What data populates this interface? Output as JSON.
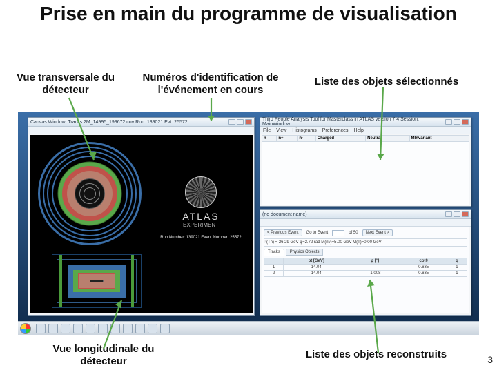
{
  "title": "Prise en main du programme de visualisation",
  "labels": {
    "transverse": "Vue transversale du détecteur",
    "evtid": "Numéros d'identification de l'événement en cours",
    "selected": "Liste des objets sélectionnés",
    "longitudinal": "Vue longitudinale du détecteur",
    "reconstructed": "Liste des objets reconstruits"
  },
  "page_number": "3",
  "canvas_window": {
    "title": "Canvas Window: Tracks 2M_14995_199672.cov Run: 139021 Evt: 25572",
    "atlas_text": "ATLAS",
    "atlas_sub": "EXPERIMENT",
    "atlas_run": "Run Number: 139021 Event Number: 25572"
  },
  "browser_window": {
    "title": "Third People Analysis Tool for Masterclass in ATLAS  version 7.4  Session: MainWindow",
    "menu": [
      "File",
      "View",
      "Histograms",
      "Preferences",
      "Help"
    ],
    "columns": [
      "n",
      "n+",
      "n-",
      "Charged",
      "Neutral",
      "MInvariant"
    ]
  },
  "data_window": {
    "title": "(no document name)",
    "nav": {
      "prev": "< Previous Event",
      "goto": "Go to Event",
      "of": "of 50",
      "next": "Next Event >"
    },
    "summary": "P(Tn) = 26.29 GeV    φ=2.72 rad    M(nv)=5.00 GeV   M(T)=0.00 GeV",
    "tabs": [
      "Tracks",
      "Physics Objects"
    ],
    "table": {
      "headers": [
        "",
        "pt [GeV]",
        "φ [°]",
        "cotθ",
        "q"
      ],
      "rows": [
        [
          "1",
          "14.04",
          "",
          "0.635",
          "1"
        ],
        [
          "2",
          "14.04",
          "-1.008",
          "0.635",
          "1"
        ]
      ]
    }
  }
}
